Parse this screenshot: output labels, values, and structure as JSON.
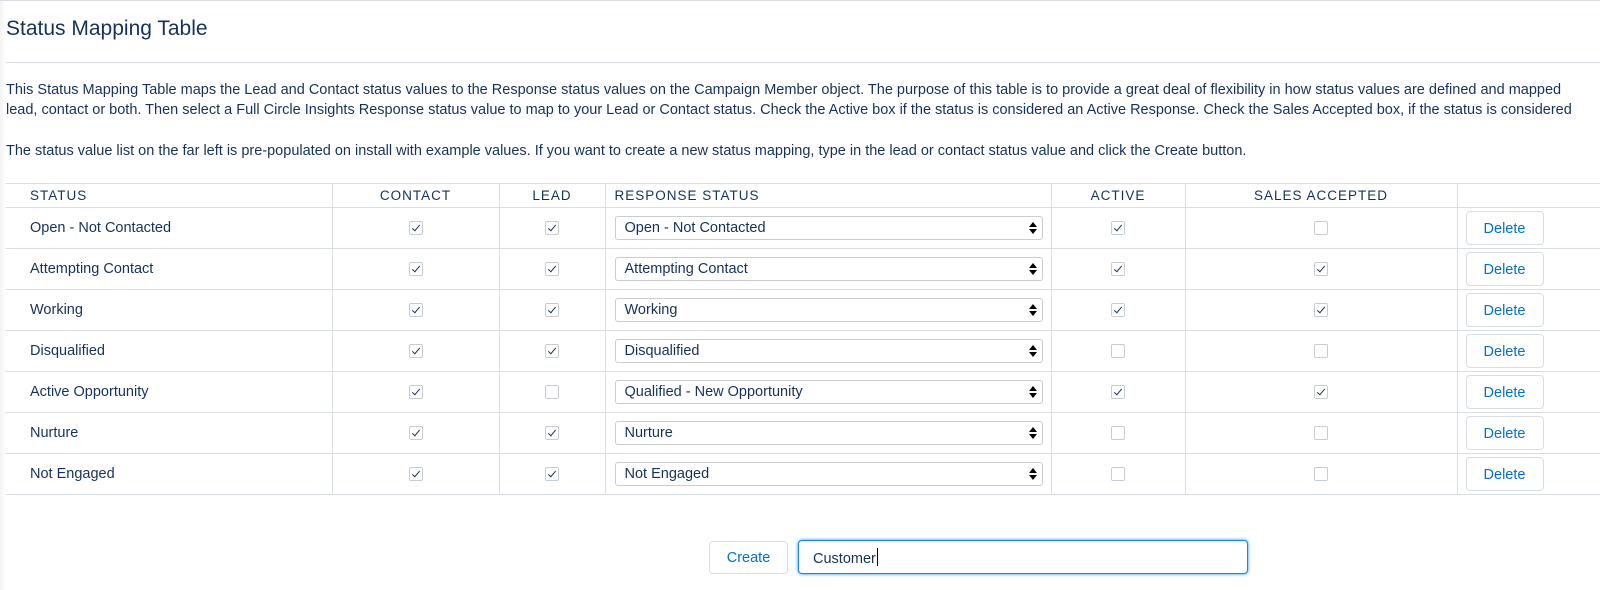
{
  "page": {
    "title": "Status Mapping Table",
    "description_line1": "This Status Mapping Table maps the Lead and Contact status values to the Response status values on the Campaign Member object. The purpose of this table is to provide a great deal of flexibility in how status values are defined and mapped",
    "description_line2": "lead, contact or both. Then select a Full Circle Insights Response status value to map to your Lead or Contact status. Check the Active box if the status is considered an Active Response. Check the Sales Accepted box, if the status is considered",
    "description_line3": "The status value list on the far left is pre-populated on install with example values. If you want to create a new status mapping, type in the lead or contact status value and click the Create button."
  },
  "table": {
    "headers": {
      "status": "STATUS",
      "contact": "CONTACT",
      "lead": "LEAD",
      "response_status": "RESPONSE STATUS",
      "active": "ACTIVE",
      "sales_accepted": "SALES ACCEPTED"
    },
    "delete_label": "Delete",
    "rows": [
      {
        "status": "Open - Not Contacted",
        "contact": true,
        "lead": true,
        "response": "Open - Not Contacted",
        "active": true,
        "sales_accepted": false
      },
      {
        "status": "Attempting Contact",
        "contact": true,
        "lead": true,
        "response": "Attempting Contact",
        "active": true,
        "sales_accepted": true
      },
      {
        "status": "Working",
        "contact": true,
        "lead": true,
        "response": "Working",
        "active": true,
        "sales_accepted": true
      },
      {
        "status": "Disqualified",
        "contact": true,
        "lead": true,
        "response": "Disqualified",
        "active": false,
        "sales_accepted": false
      },
      {
        "status": "Active Opportunity",
        "contact": true,
        "lead": false,
        "response": "Qualified - New Opportunity",
        "active": true,
        "sales_accepted": true
      },
      {
        "status": "Nurture",
        "contact": true,
        "lead": true,
        "response": "Nurture",
        "active": false,
        "sales_accepted": false
      },
      {
        "status": "Not Engaged",
        "contact": true,
        "lead": true,
        "response": "Not Engaged",
        "active": false,
        "sales_accepted": false
      }
    ]
  },
  "create": {
    "button_label": "Create",
    "input_value": "Customer"
  },
  "colors": {
    "text": "#16325c",
    "link": "#0070d2",
    "border": "#d8dde6",
    "focus": "#1589ee"
  }
}
